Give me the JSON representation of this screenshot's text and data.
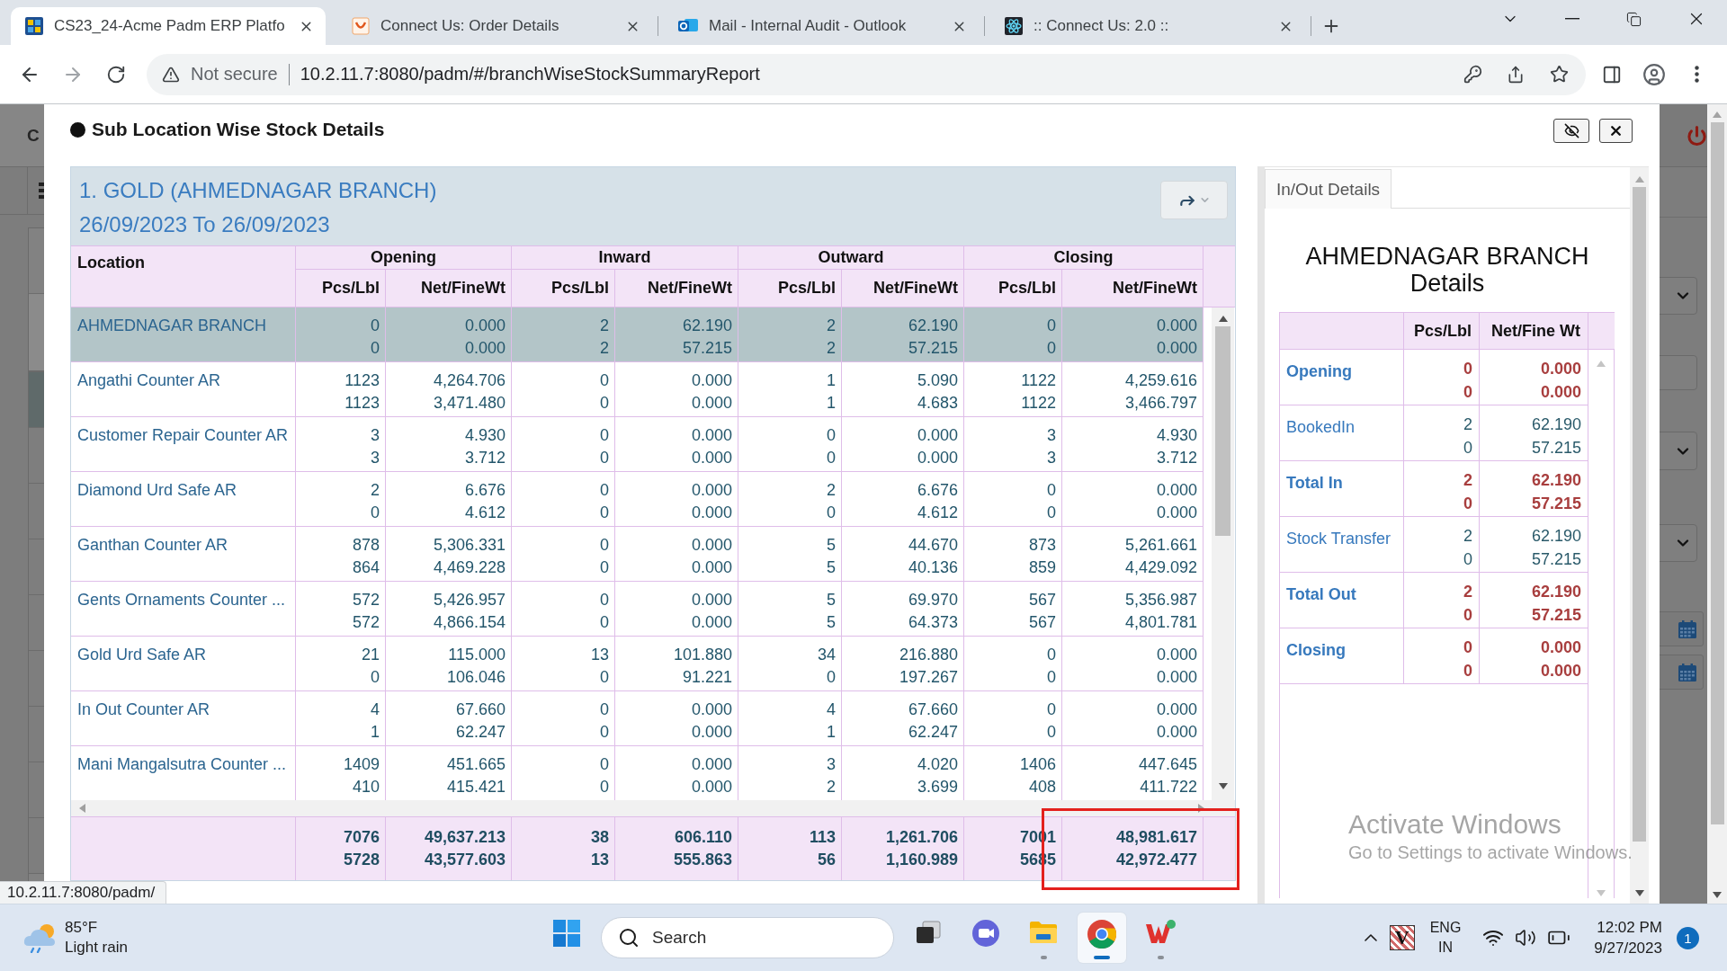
{
  "browser": {
    "tabs": [
      {
        "kind": "grid",
        "title": "CS23_24-Acme Padm ERP Platfo",
        "selected": true
      },
      {
        "kind": "swoosh",
        "title": "Connect Us: Order Details",
        "selected": false
      },
      {
        "kind": "ring",
        "title": "Mail - Internal Audit - Outlook",
        "selected": false
      },
      {
        "kind": "atom",
        "title": ":: Connect Us: 2.0 ::",
        "selected": false
      }
    ],
    "security": "Not secure",
    "url": "10.2.11.7:8080/padm/#/branchWiseStockSummaryReport",
    "status_url": "10.2.11.7:8080/padm/"
  },
  "backdrop": {
    "title": "C",
    "rows": [
      {
        "selected": true
      },
      {
        "selected": false
      },
      {
        "selected": false
      },
      {
        "selected": false
      },
      {
        "selected": false
      },
      {
        "selected": false
      },
      {
        "selected": false
      },
      {
        "selected": false
      },
      {
        "selected": false
      }
    ]
  },
  "dialog": {
    "title": "Sub Location Wise Stock Details",
    "report": {
      "title": "1. GOLD (AHMEDNAGAR BRANCH)",
      "period": "26/09/2023 To 26/09/2023",
      "location_header": "Location",
      "groups": [
        {
          "label": "Opening",
          "columns": [
            "Pcs/Lbl",
            "Net/FineWt"
          ]
        },
        {
          "label": "Inward",
          "columns": [
            "Pcs/Lbl",
            "Net/FineWt"
          ]
        },
        {
          "label": "Outward",
          "columns": [
            "Pcs/Lbl",
            "Net/FineWt"
          ]
        },
        {
          "label": "Closing",
          "columns": [
            "Pcs/Lbl",
            "Net/FineWt"
          ]
        }
      ],
      "rows": [
        {
          "location": "AHMEDNAGAR BRANCH",
          "selected": true,
          "cells": [
            [
              "0",
              "0"
            ],
            [
              "0.000",
              "0.000"
            ],
            [
              "2",
              "2"
            ],
            [
              "62.190",
              "57.215"
            ],
            [
              "2",
              "2"
            ],
            [
              "62.190",
              "57.215"
            ],
            [
              "0",
              "0"
            ],
            [
              "0.000",
              "0.000"
            ]
          ]
        },
        {
          "location": "Angathi Counter AR",
          "selected": false,
          "cells": [
            [
              "1123",
              "1123"
            ],
            [
              "4,264.706",
              "3,471.480"
            ],
            [
              "0",
              "0"
            ],
            [
              "0.000",
              "0.000"
            ],
            [
              "1",
              "1"
            ],
            [
              "5.090",
              "4.683"
            ],
            [
              "1122",
              "1122"
            ],
            [
              "4,259.616",
              "3,466.797"
            ]
          ]
        },
        {
          "location": "Customer Repair Counter AR",
          "selected": false,
          "cells": [
            [
              "3",
              "3"
            ],
            [
              "4.930",
              "3.712"
            ],
            [
              "0",
              "0"
            ],
            [
              "0.000",
              "0.000"
            ],
            [
              "0",
              "0"
            ],
            [
              "0.000",
              "0.000"
            ],
            [
              "3",
              "3"
            ],
            [
              "4.930",
              "3.712"
            ]
          ]
        },
        {
          "location": "Diamond Urd Safe AR",
          "selected": false,
          "cells": [
            [
              "2",
              "0"
            ],
            [
              "6.676",
              "4.612"
            ],
            [
              "0",
              "0"
            ],
            [
              "0.000",
              "0.000"
            ],
            [
              "2",
              "0"
            ],
            [
              "6.676",
              "4.612"
            ],
            [
              "0",
              "0"
            ],
            [
              "0.000",
              "0.000"
            ]
          ]
        },
        {
          "location": "Ganthan Counter AR",
          "selected": false,
          "cells": [
            [
              "878",
              "864"
            ],
            [
              "5,306.331",
              "4,469.228"
            ],
            [
              "0",
              "0"
            ],
            [
              "0.000",
              "0.000"
            ],
            [
              "5",
              "5"
            ],
            [
              "44.670",
              "40.136"
            ],
            [
              "873",
              "859"
            ],
            [
              "5,261.661",
              "4,429.092"
            ]
          ]
        },
        {
          "location": "Gents Ornaments Counter ...",
          "selected": false,
          "cells": [
            [
              "572",
              "572"
            ],
            [
              "5,426.957",
              "4,866.154"
            ],
            [
              "0",
              "0"
            ],
            [
              "0.000",
              "0.000"
            ],
            [
              "5",
              "5"
            ],
            [
              "69.970",
              "64.373"
            ],
            [
              "567",
              "567"
            ],
            [
              "5,356.987",
              "4,801.781"
            ]
          ]
        },
        {
          "location": "Gold Urd Safe AR",
          "selected": false,
          "cells": [
            [
              "21",
              "0"
            ],
            [
              "115.000",
              "106.046"
            ],
            [
              "13",
              "0"
            ],
            [
              "101.880",
              "91.221"
            ],
            [
              "34",
              "0"
            ],
            [
              "216.880",
              "197.267"
            ],
            [
              "0",
              "0"
            ],
            [
              "0.000",
              "0.000"
            ]
          ]
        },
        {
          "location": "In Out Counter AR",
          "selected": false,
          "cells": [
            [
              "4",
              "1"
            ],
            [
              "67.660",
              "62.247"
            ],
            [
              "0",
              "0"
            ],
            [
              "0.000",
              "0.000"
            ],
            [
              "4",
              "1"
            ],
            [
              "67.660",
              "62.247"
            ],
            [
              "0",
              "0"
            ],
            [
              "0.000",
              "0.000"
            ]
          ]
        },
        {
          "location": "Mani Mangalsutra Counter ...",
          "selected": false,
          "cells": [
            [
              "1409",
              "410"
            ],
            [
              "451.665",
              "415.421"
            ],
            [
              "0",
              "0"
            ],
            [
              "0.000",
              "0.000"
            ],
            [
              "3",
              "2"
            ],
            [
              "4.020",
              "3.699"
            ],
            [
              "1406",
              "408"
            ],
            [
              "447.645",
              "411.722"
            ]
          ]
        }
      ],
      "totals": [
        {
          "lines": [
            "7076",
            "5728"
          ],
          "highlighted": false
        },
        {
          "lines": [
            "49,637.213",
            "43,577.603"
          ],
          "highlighted": false
        },
        {
          "lines": [
            "38",
            "13"
          ],
          "highlighted": false
        },
        {
          "lines": [
            "606.110",
            "555.863"
          ],
          "highlighted": false
        },
        {
          "lines": [
            "113",
            "56"
          ],
          "highlighted": false
        },
        {
          "lines": [
            "1,261.706",
            "1,160.989"
          ],
          "highlighted": false
        },
        {
          "lines": [
            "7001",
            "5685"
          ],
          "highlighted": false
        },
        {
          "lines": [
            "48,981.617",
            "42,972.477"
          ],
          "highlighted": true
        }
      ]
    },
    "side_panel": {
      "tabs": [
        {
          "label": "In/Out Details",
          "selected": true
        }
      ],
      "heading": "AHMEDNAGAR BRANCH Details",
      "columns": [
        "Pcs/Lbl",
        "Net/Fine Wt"
      ],
      "rows": [
        {
          "kind": "total",
          "label": "Opening",
          "pcs": [
            "0",
            "0"
          ],
          "weight": [
            "0.000",
            "0.000"
          ]
        },
        {
          "kind": "entry",
          "label": "BookedIn",
          "pcs": [
            "2",
            "0"
          ],
          "weight": [
            "62.190",
            "57.215"
          ]
        },
        {
          "kind": "total",
          "label": "Total In",
          "pcs": [
            "2",
            "0"
          ],
          "weight": [
            "62.190",
            "57.215"
          ]
        },
        {
          "kind": "entry",
          "label": "Stock Transfer",
          "pcs": [
            "2",
            "0"
          ],
          "weight": [
            "62.190",
            "57.215"
          ]
        },
        {
          "kind": "total",
          "label": "Total Out",
          "pcs": [
            "2",
            "0"
          ],
          "weight": [
            "62.190",
            "57.215"
          ]
        },
        {
          "kind": "total",
          "label": "Closing",
          "pcs": [
            "0",
            "0"
          ],
          "weight": [
            "0.000",
            "0.000"
          ]
        }
      ]
    }
  },
  "activation_notice": {
    "title": "Activate Windows",
    "text": "Go to Settings to activate Windows."
  },
  "taskbar": {
    "weather": {
      "temperature": "85°F",
      "condition": "Light rain"
    },
    "search": {
      "placeholder": "Search"
    },
    "apps": [
      {
        "kind": "task-view",
        "running": false,
        "selected": false
      },
      {
        "kind": "video-call",
        "running": false,
        "selected": false
      },
      {
        "kind": "files",
        "running": true,
        "selected": false
      },
      {
        "kind": "browser",
        "running": true,
        "selected": true
      },
      {
        "kind": "office",
        "running": true,
        "selected": false
      }
    ],
    "tray_app": "V",
    "language": "ENG",
    "region": "IN",
    "time": "12:02 PM",
    "date": "9/27/2023",
    "notifications": "1"
  }
}
